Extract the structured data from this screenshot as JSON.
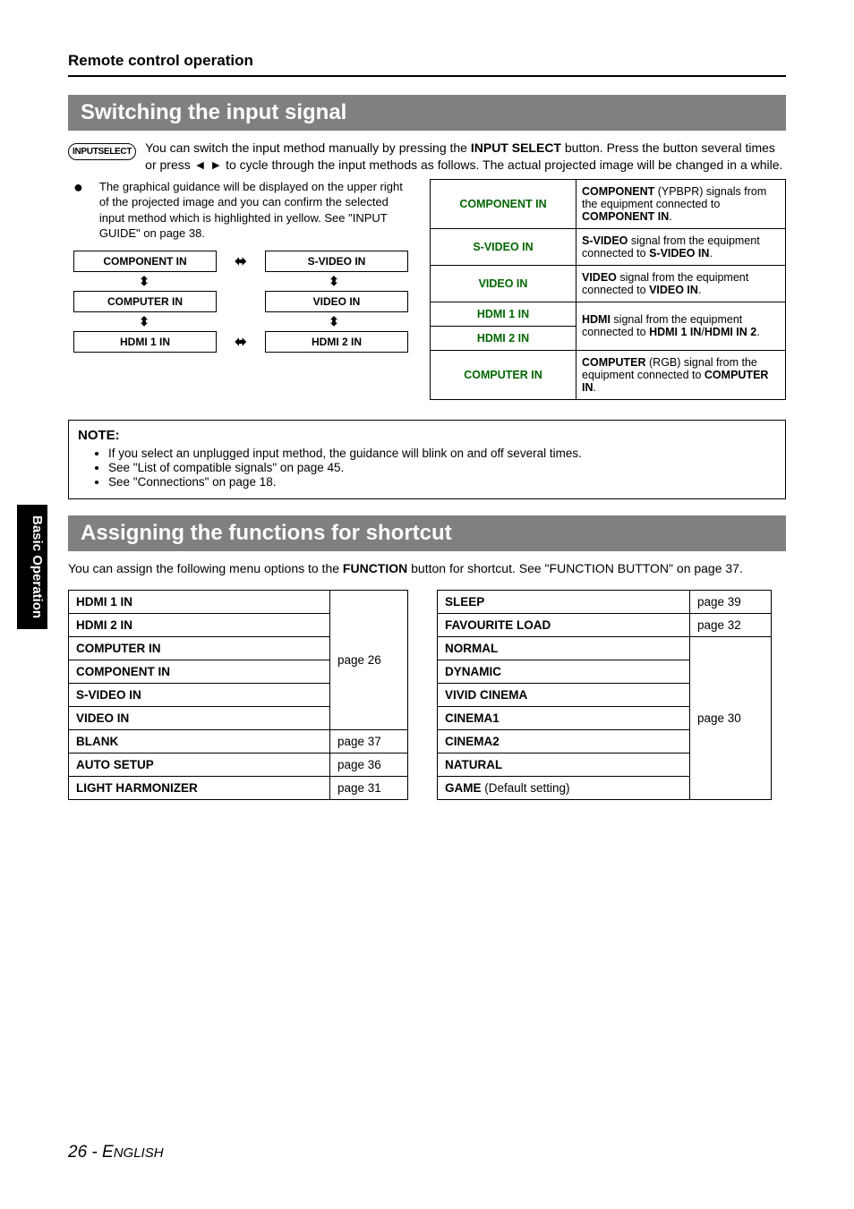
{
  "sidetab": "Basic Operation",
  "section_title": "Remote control operation",
  "h1": "Switching the input signal",
  "inputselect_label": "INPUTSELECT",
  "intro_pre": "You can switch the input method manually by pressing the ",
  "intro_bold1": "INPUT SELECT",
  "intro_mid": " button. Press the button several times or press ◄ ► to cycle through the input methods as follows. The actual projected image will be changed in a while.",
  "bullet_text_pre": "The graphical guidance will be displayed on the upper right of the projected image and you can confirm the selected input method which is highlighted in yellow. See \"INPUT GUIDE\" on page 38.",
  "flow": {
    "r1a": "COMPONENT IN",
    "r1b": "S-VIDEO IN",
    "r2a": "COMPUTER IN",
    "r2b": "VIDEO IN",
    "r3a": "HDMI 1 IN",
    "r3b": "HDMI 2 IN"
  },
  "sig": {
    "component_k": "COMPONENT IN",
    "component_v_b1": "COMPONENT",
    "component_v_t1": " (YPBPR) signals from the equipment connected to ",
    "component_v_b2": "COMPONENT IN",
    "svideo_k": "S-VIDEO IN",
    "svideo_v_b1": "S-VIDEO",
    "svideo_v_t1": " signal from the equipment connected to ",
    "svideo_v_b2": "S-VIDEO IN",
    "video_k": "VIDEO IN",
    "video_v_b1": "VIDEO",
    "video_v_t1": " signal from the equipment connected to ",
    "video_v_b2": "VIDEO IN",
    "hdmi1_k": "HDMI 1 IN",
    "hdmi2_k": "HDMI 2 IN",
    "hdmi_v_b1": "HDMI",
    "hdmi_v_t1": " signal from the equipment connected to ",
    "hdmi_v_b2": "HDMI 1 IN",
    "hdmi_v_t2": "/",
    "hdmi_v_b3": "HDMI IN 2",
    "computer_k": "COMPUTER IN",
    "computer_v_b1": "COMPUTER",
    "computer_v_t1": " (RGB) signal from the equipment connected to ",
    "computer_v_b2": "COMPUTER IN"
  },
  "note": {
    "title": "NOTE:",
    "i1": "If you select an unplugged input method, the guidance will blink on and off several times.",
    "i2": "See \"List of compatible signals\" on page 45.",
    "i3": "See \"Connections\" on page 18."
  },
  "h2": "Assigning the functions for shortcut",
  "assign_desc_pre": "You can assign the following menu options to the ",
  "assign_desc_bold": "FUNCTION",
  "assign_desc_post": " button for shortcut. See \"FUNCTION BUTTON\" on page 37.",
  "ft1": {
    "hdmi1": "HDMI 1 IN",
    "hdmi2": "HDMI 2 IN",
    "computer": "COMPUTER IN",
    "component": "COMPONENT IN",
    "svideo": "S-VIDEO IN",
    "video": "VIDEO IN",
    "p26": "page 26",
    "blank": "BLANK",
    "p37": "page 37",
    "auto": "AUTO SETUP",
    "p36": "page 36",
    "light": "LIGHT HARMONIZER",
    "p31": "page 31"
  },
  "ft2": {
    "sleep": "SLEEP",
    "p39": "page 39",
    "fav": "FAVOURITE LOAD",
    "p32": "page 32",
    "normal": "NORMAL",
    "dynamic": "DYNAMIC",
    "vivid": "VIVID CINEMA",
    "c1": "CINEMA1",
    "c2": "CINEMA2",
    "natural": "NATURAL",
    "game_b": "GAME",
    "game_t": " (Default setting)",
    "p30": "page 30"
  },
  "footer_page": "26",
  "footer_sep": " - ",
  "footer_lang_first": "E",
  "footer_lang_rest": "NGLISH"
}
